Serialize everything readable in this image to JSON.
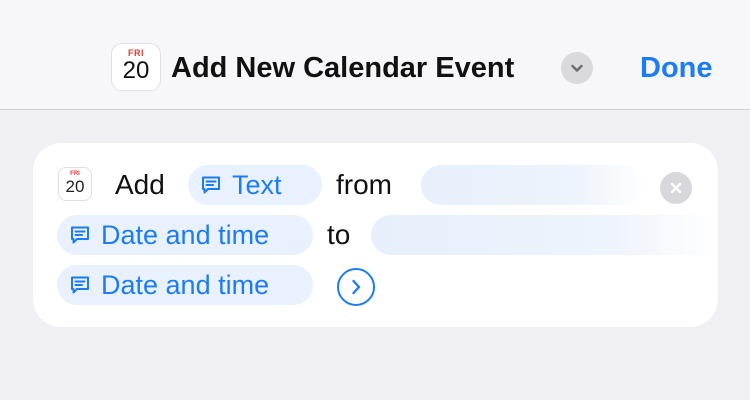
{
  "header": {
    "app_icon": {
      "weekday": "FRI",
      "day": "20"
    },
    "title": "Add New Calendar Event",
    "expand_icon": "chevron-down-icon",
    "done_label": "Done"
  },
  "action": {
    "icon": {
      "weekday": "FRI",
      "day": "20"
    },
    "verb": "Add",
    "title_token": {
      "icon": "text-bubble-icon",
      "label": "Text"
    },
    "from_word": "from",
    "calendar_field": "",
    "start_token": {
      "icon": "text-bubble-icon",
      "label": "Date and time"
    },
    "to_word": "to",
    "location_field": "",
    "end_token": {
      "icon": "text-bubble-icon",
      "label": "Date and time"
    },
    "clear_icon": "clear-icon",
    "expand_icon": "chevron-right-circle-icon"
  },
  "colors": {
    "accent": "#1c7cf4",
    "background": "#efeff4",
    "card": "#ffffff",
    "token_bg": "#e8f1fd"
  }
}
